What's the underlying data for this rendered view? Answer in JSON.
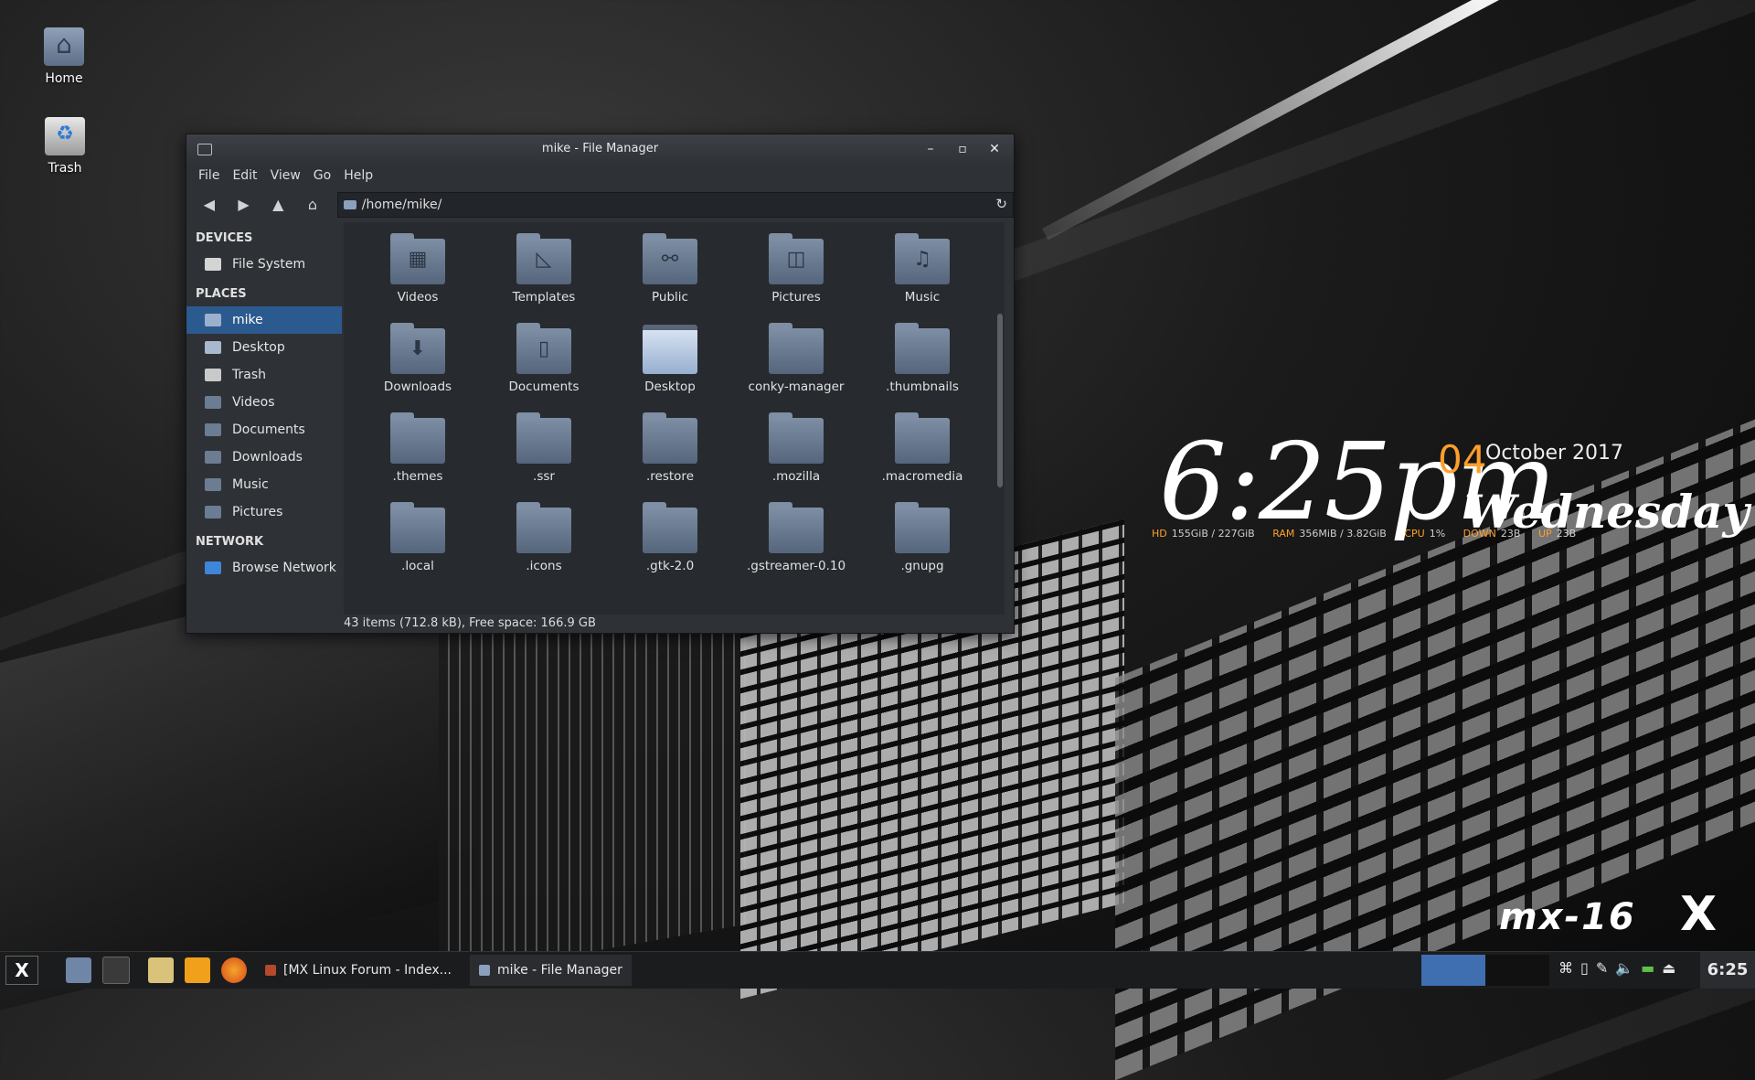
{
  "desktop": {
    "icons": [
      {
        "label": "Home",
        "icon": "home-icon"
      },
      {
        "label": "Trash",
        "icon": "trash-icon"
      }
    ]
  },
  "conky": {
    "time": "6:25pm",
    "day": "04",
    "month_year": "October 2017",
    "weekday": "Wednesday",
    "stats": [
      {
        "key": "HD",
        "value": "155GiB / 227GiB"
      },
      {
        "key": "RAM",
        "value": "356MiB / 3.82GiB"
      },
      {
        "key": "CPU",
        "value": "1%"
      },
      {
        "key": "DOWN",
        "value": "23B"
      },
      {
        "key": "UP",
        "value": "23B"
      }
    ],
    "logo": "mx-16"
  },
  "window": {
    "title": "mike - File Manager",
    "controls": {
      "minimize": "–",
      "maximize": "▫",
      "close": "✕"
    },
    "menu": [
      "File",
      "Edit",
      "View",
      "Go",
      "Help"
    ],
    "path": "/home/mike/",
    "sidebar": {
      "devices_header": "DEVICES",
      "devices": [
        {
          "label": "File System",
          "icon": "drive-icon"
        }
      ],
      "places_header": "PLACES",
      "places": [
        {
          "label": "mike",
          "icon": "home-icon",
          "selected": true
        },
        {
          "label": "Desktop",
          "icon": "desktop-icon"
        },
        {
          "label": "Trash",
          "icon": "trash-icon"
        },
        {
          "label": "Videos",
          "icon": "folder-icon"
        },
        {
          "label": "Documents",
          "icon": "folder-icon"
        },
        {
          "label": "Downloads",
          "icon": "folder-icon"
        },
        {
          "label": "Music",
          "icon": "folder-icon"
        },
        {
          "label": "Pictures",
          "icon": "folder-icon"
        }
      ],
      "network_header": "NETWORK",
      "network": [
        {
          "label": "Browse Network",
          "icon": "network-icon"
        }
      ]
    },
    "files": [
      {
        "name": "Videos",
        "glyph": "▦"
      },
      {
        "name": "Templates",
        "glyph": "◺"
      },
      {
        "name": "Public",
        "glyph": "⚯"
      },
      {
        "name": "Pictures",
        "glyph": "◫"
      },
      {
        "name": "Music",
        "glyph": "♫"
      },
      {
        "name": "Downloads",
        "glyph": "⬇"
      },
      {
        "name": "Documents",
        "glyph": "▯"
      },
      {
        "name": "Desktop",
        "glyph": ""
      },
      {
        "name": "conky-manager",
        "glyph": ""
      },
      {
        "name": ".thumbnails",
        "glyph": ""
      },
      {
        "name": ".themes",
        "glyph": ""
      },
      {
        "name": ".ssr",
        "glyph": ""
      },
      {
        "name": ".restore",
        "glyph": ""
      },
      {
        "name": ".mozilla",
        "glyph": ""
      },
      {
        "name": ".macromedia",
        "glyph": ""
      },
      {
        "name": ".local",
        "glyph": ""
      },
      {
        "name": ".icons",
        "glyph": ""
      },
      {
        "name": ".gtk-2.0",
        "glyph": ""
      },
      {
        "name": ".gstreamer-0.10",
        "glyph": ""
      },
      {
        "name": ".gnupg",
        "glyph": ""
      }
    ],
    "status": "43 items (712.8 kB), Free space: 166.9 GB"
  },
  "taskbar": {
    "logo": "X",
    "tasks": [
      {
        "label": "[MX Linux Forum - Index...",
        "icon": "firefox-icon"
      },
      {
        "label": "mike - File Manager",
        "icon": "folder-icon"
      }
    ],
    "clock": "6:25"
  },
  "colors": {
    "accent": "#ff9f2a",
    "selection": "#2b5a8f"
  }
}
